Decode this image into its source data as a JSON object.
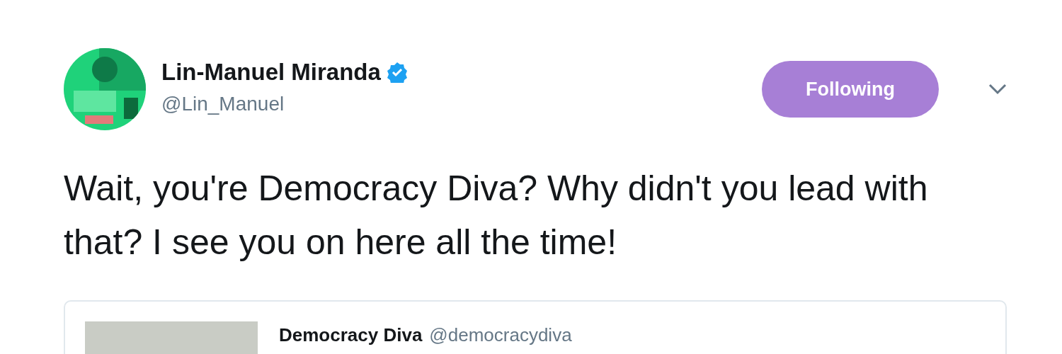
{
  "author": {
    "name": "Lin-Manuel Miranda",
    "verified": true,
    "handle": "@Lin_Manuel"
  },
  "follow_button": {
    "label": "Following",
    "following": true
  },
  "tweet_text": "Wait, you're Democracy Diva? Why didn't you lead with that? I see you on here all the time!",
  "quoted_tweet": {
    "name": "Democracy Diva",
    "handle": "@democracydiva"
  }
}
